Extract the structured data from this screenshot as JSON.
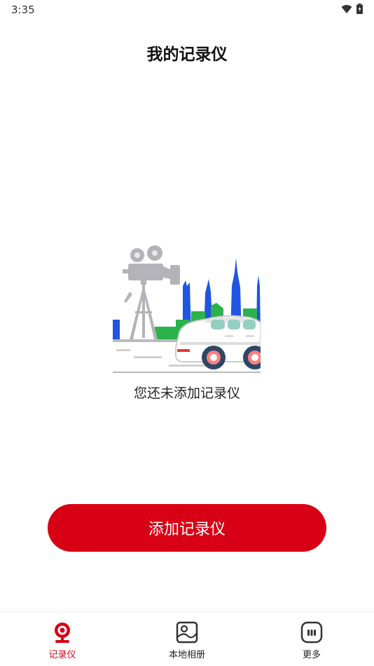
{
  "status_bar": {
    "time": "3:35"
  },
  "header": {
    "title": "我的记录仪"
  },
  "empty_state": {
    "message": "您还未添加记录仪"
  },
  "actions": {
    "add_label": "添加记录仪"
  },
  "bottom_nav": {
    "items": [
      {
        "label": "记录仪",
        "icon": "recorder-icon",
        "active": true
      },
      {
        "label": "本地相册",
        "icon": "album-icon",
        "active": false
      },
      {
        "label": "更多",
        "icon": "more-icon",
        "active": false
      }
    ]
  },
  "colors": {
    "accent": "#d70014",
    "background": "#ffffff"
  }
}
